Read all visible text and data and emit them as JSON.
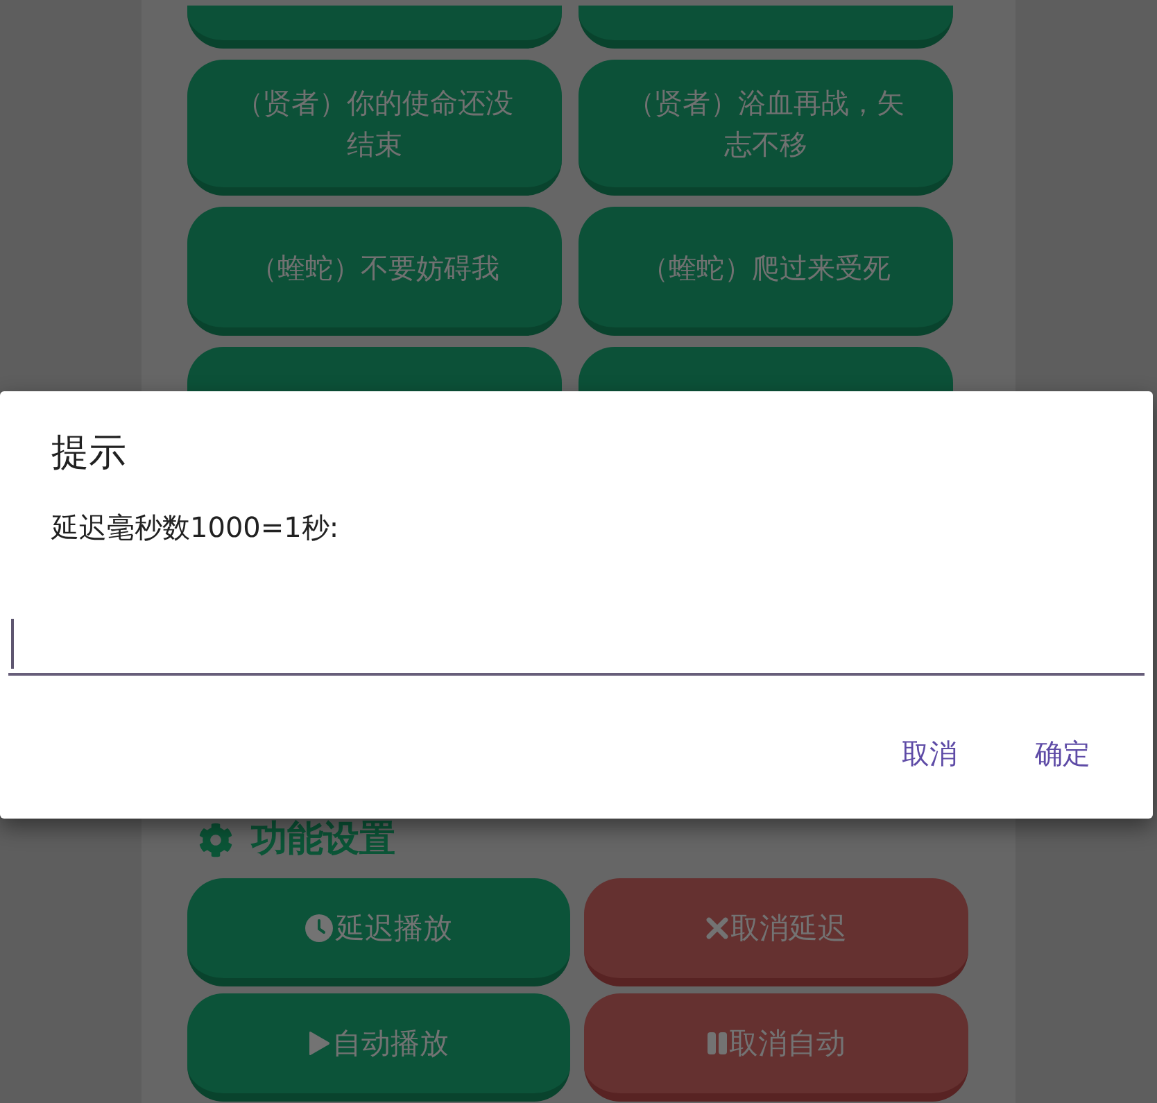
{
  "sound_buttons": [
    {
      "kind": "tail"
    },
    {
      "kind": "tail"
    },
    {
      "kind": "full",
      "label": "（贤者）你的使命还没结束"
    },
    {
      "kind": "full",
      "label": "（贤者）浴血再战，矢志不移"
    },
    {
      "kind": "full",
      "label": "（蝰蛇）不要妨碍我"
    },
    {
      "kind": "full",
      "label": "（蝰蛇）爬过来受死"
    },
    {
      "kind": "head"
    },
    {
      "kind": "head"
    }
  ],
  "settings": {
    "title": "功能设置",
    "buttons": [
      {
        "kind": "delay",
        "label": "延迟播放"
      },
      {
        "kind": "cancel-delay",
        "label": "取消延迟"
      },
      {
        "kind": "autoplay",
        "label": "自动播放"
      },
      {
        "kind": "stop-autoplay",
        "label": "取消自动"
      }
    ]
  },
  "dialog": {
    "title": "提示",
    "message": "延迟毫秒数1000=1秒:",
    "input": {
      "focused": true
    },
    "buttons": [
      "取消",
      "确定"
    ]
  }
}
